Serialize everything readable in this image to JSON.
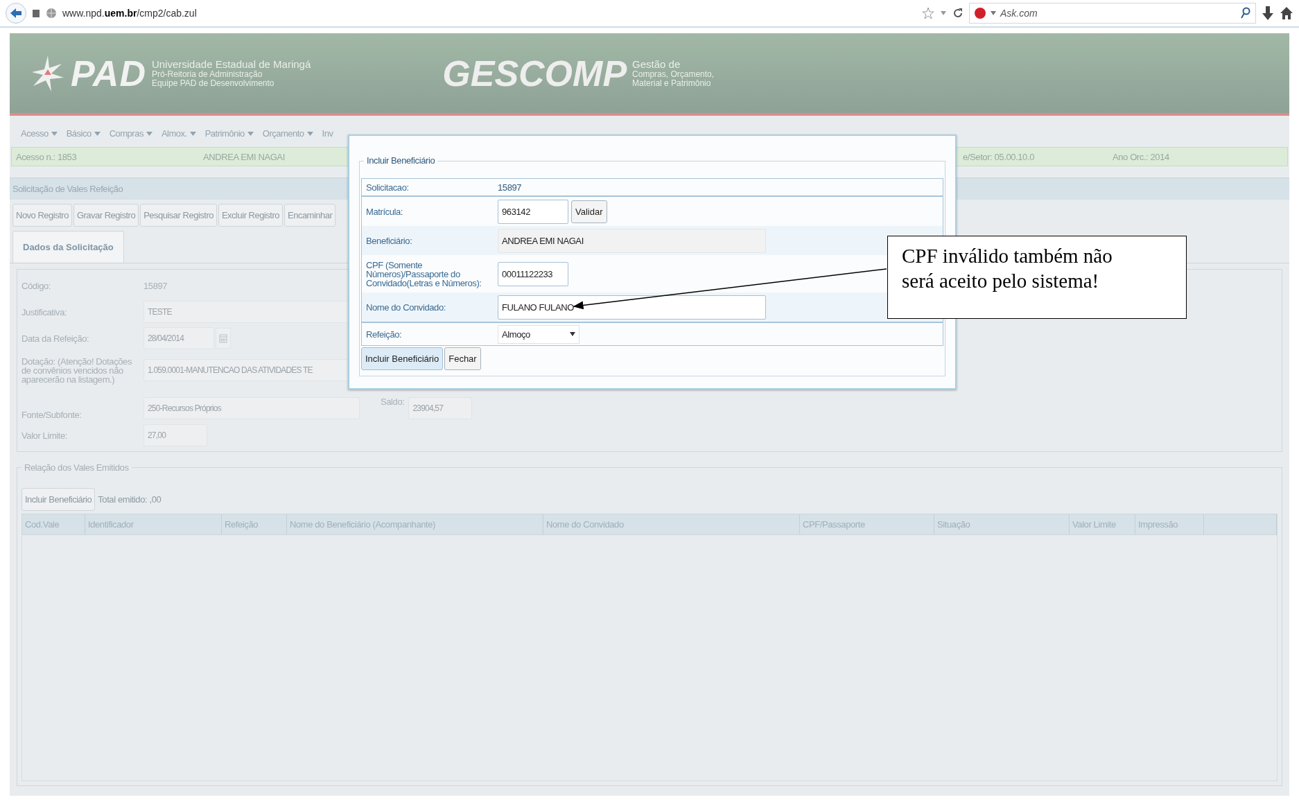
{
  "browser": {
    "address": "www.npd.**uem.br**/cmp2/cab.zul",
    "search_engine": "Ask.com"
  },
  "header": {
    "logo_text": "PAD",
    "institution": [
      "Universidade Estadual de Maringá",
      "Pró-Reitoria de Administração",
      "Equipe PAD de Desenvolvimento"
    ],
    "system_name": "GESCOMP",
    "system_subtitle": [
      "Gestão de",
      "Compras, Orçamento,",
      "Material e Patrimônio"
    ]
  },
  "menu": [
    {
      "label": "Acesso",
      "dropdown": true
    },
    {
      "label": "Básico",
      "dropdown": true
    },
    {
      "label": "Compras",
      "dropdown": true
    },
    {
      "label": "Almox.",
      "dropdown": true
    },
    {
      "label": "Patrimônio",
      "dropdown": true
    },
    {
      "label": "Orçamento",
      "dropdown": true
    },
    {
      "label": "Inv",
      "dropdown": false
    }
  ],
  "info_bar": [
    "Acesso n.: 1853",
    "ANDREA EMI NAGAI",
    "e/Setor: 05.00.10.0",
    "Ano Orc.: 2014"
  ],
  "panel": {
    "title": "Solicitação de Vales Refeição",
    "toolbar": [
      "Novo Registro",
      "Gravar Registro",
      "Pesquisar Registro",
      "Excluir Registro",
      "Encaminhar"
    ],
    "tabs": [
      {
        "label": "Dados da Solicitação",
        "selected": true
      }
    ],
    "fields": [
      {
        "kind": "text",
        "label": "Código:",
        "value": "15897"
      },
      {
        "kind": "input",
        "label": "Justificativa:",
        "value": "TESTE"
      },
      {
        "kind": "date",
        "label": "Data da Refeição:",
        "value": "28/04/2014"
      },
      {
        "kind": "input",
        "label": "Dotação: (Atenção! Dotações de convênios vencidos não aparecerão na listagem.)",
        "value": "1.059.0001-MANUTENCAO DAS ATIVIDADES TE"
      },
      {
        "kind": "input_saldo",
        "label": "Fonte/Subfonte:",
        "value": "250-Recursos Próprios",
        "extra_label": "Saldo:",
        "extra_value": "23904,57"
      },
      {
        "kind": "short",
        "label": "Valor Limite:",
        "value": "27,00"
      }
    ]
  },
  "issued": {
    "legend": "Relação dos Vales Emitidos",
    "button": "Incluir Beneficiário",
    "total": "Total emitido: ,00",
    "columns": [
      "Cod.Vale",
      "Identificador",
      "Refeição",
      "Nome do Beneficiário (Acompanhante)",
      "Nome do Convidado",
      "CPF/Passaporte",
      "Situação",
      "Valor Limite",
      "Impressão"
    ]
  },
  "dialog": {
    "legend": "Incluir Beneficiário",
    "rows": [
      {
        "kind": "text",
        "label": "Solicitacao:",
        "value": "15897"
      },
      {
        "kind": "input_button",
        "label": "Matrícula:",
        "value": "963142",
        "button": "Validar"
      },
      {
        "kind": "readonly",
        "label": "Beneficiário:",
        "value": "ANDREA EMI NAGAI"
      },
      {
        "kind": "input",
        "label": "CPF (Somente Números)/Passaporte do Convidado(Letras e Números):",
        "value": "00011122233"
      },
      {
        "kind": "wide_input",
        "label": "Nome do Convidado:",
        "value": "FULANO FULANO"
      },
      {
        "kind": "select",
        "label": "Refeição:",
        "value": "Almoço"
      }
    ],
    "buttons": [
      {
        "label": "Incluir Beneficiário",
        "focused": true
      },
      {
        "label": "Fechar",
        "focused": false
      }
    ]
  },
  "callout": {
    "text": "CPF inválido também não será aceito pelo sistema!"
  }
}
